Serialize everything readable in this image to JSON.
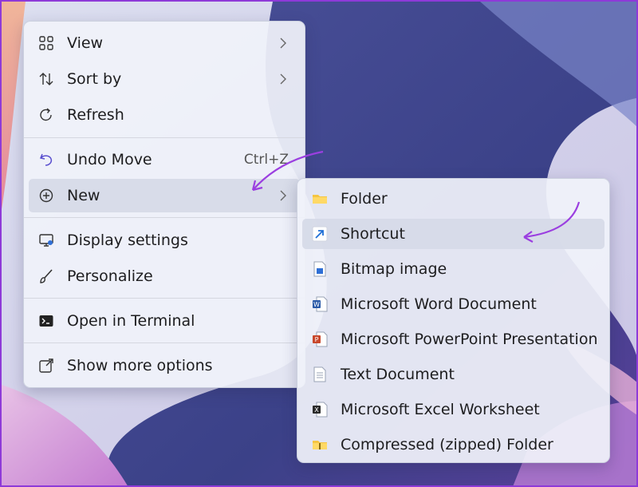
{
  "colors": {
    "accent_arrow": "#9b3fe0",
    "frame_border": "#8e3ad8",
    "wallpaper_dark": "#3f468f",
    "wallpaper_light": "#c8cce6"
  },
  "context_menu": {
    "items": [
      {
        "label": "View",
        "icon": "grid-view-icon",
        "has_submenu": true
      },
      {
        "label": "Sort by",
        "icon": "sort-arrows-icon",
        "has_submenu": true
      },
      {
        "label": "Refresh",
        "icon": "refresh-icon",
        "has_submenu": false
      },
      {
        "label": "Undo Move",
        "icon": "undo-icon",
        "shortcut": "Ctrl+Z",
        "has_submenu": false
      },
      {
        "label": "New",
        "icon": "plus-circle-icon",
        "has_submenu": true
      },
      {
        "label": "Display settings",
        "icon": "display-settings-icon",
        "has_submenu": false
      },
      {
        "label": "Personalize",
        "icon": "paintbrush-icon",
        "has_submenu": false
      },
      {
        "label": "Open in Terminal",
        "icon": "terminal-icon",
        "has_submenu": false
      },
      {
        "label": "Show more options",
        "icon": "external-link-icon",
        "has_submenu": false
      }
    ]
  },
  "new_submenu": {
    "items": [
      {
        "label": "Folder",
        "icon": "folder-icon"
      },
      {
        "label": "Shortcut",
        "icon": "shortcut-arrow-icon"
      },
      {
        "label": "Bitmap image",
        "icon": "bitmap-file-icon"
      },
      {
        "label": "Microsoft Word Document",
        "icon": "word-document-icon"
      },
      {
        "label": "Microsoft PowerPoint Presentation",
        "icon": "powerpoint-presentation-icon"
      },
      {
        "label": "Text Document",
        "icon": "text-document-icon"
      },
      {
        "label": "Microsoft Excel Worksheet",
        "icon": "excel-worksheet-icon"
      },
      {
        "label": "Compressed (zipped) Folder",
        "icon": "zip-folder-icon"
      }
    ]
  }
}
